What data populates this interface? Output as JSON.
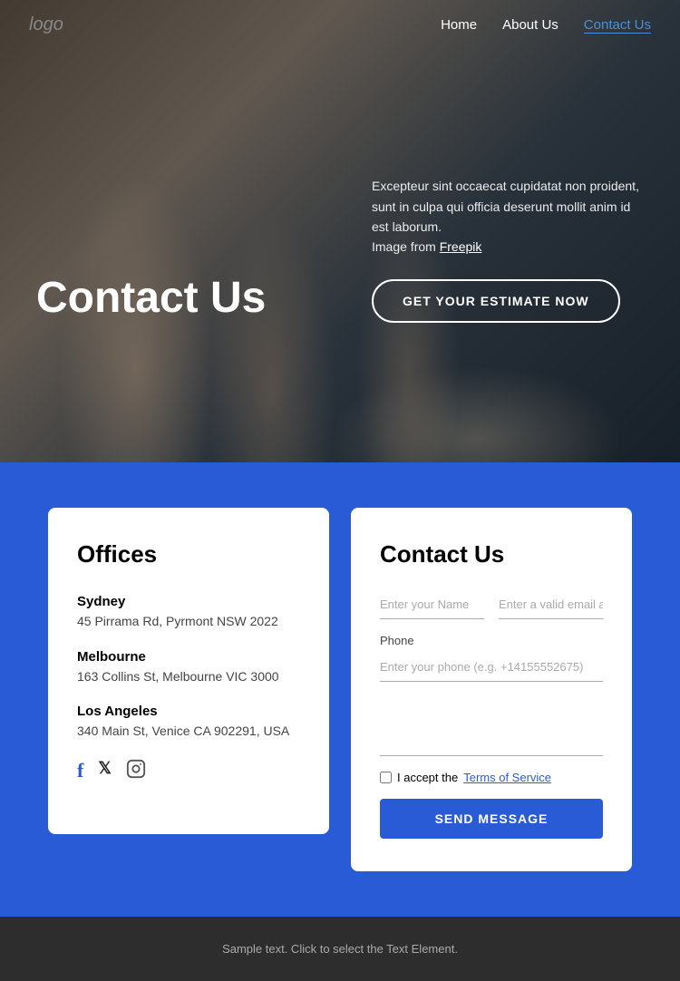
{
  "nav": {
    "logo": "logo",
    "links": [
      {
        "label": "Home",
        "href": "#",
        "active": false
      },
      {
        "label": "About Us",
        "href": "#",
        "active": false
      },
      {
        "label": "Contact Us",
        "href": "#",
        "active": true
      }
    ]
  },
  "hero": {
    "title": "Contact Us",
    "description": "Excepteur sint occaecat cupidatat non proident, sunt in culpa qui officia deserunt mollit anim id est laborum.",
    "image_credit": "Image from",
    "image_credit_link": "Freepik",
    "cta_button": "GET YOUR ESTIMATE NOW"
  },
  "offices": {
    "title": "Offices",
    "locations": [
      {
        "city": "Sydney",
        "address": "45 Pirrama Rd, Pyrmont NSW 2022"
      },
      {
        "city": "Melbourne",
        "address": "163 Collins St, Melbourne VIC 3000"
      },
      {
        "city": "Los Angeles",
        "address": "340 Main St, Venice CA 902291, USA"
      }
    ],
    "social": [
      {
        "name": "facebook",
        "symbol": "f"
      },
      {
        "name": "x-twitter",
        "symbol": "𝕏"
      },
      {
        "name": "instagram",
        "symbol": "⬡"
      }
    ]
  },
  "contact_form": {
    "title": "Contact Us",
    "name_placeholder": "Enter your Name",
    "email_placeholder": "Enter a valid email address",
    "phone_label": "Phone",
    "phone_placeholder": "Enter your phone (e.g. +14155552675)",
    "checkbox_text": "I accept the",
    "terms_label": "Terms of Service",
    "send_button": "SEND MESSAGE"
  },
  "footer": {
    "text": "Sample text. Click to select the Text Element."
  }
}
